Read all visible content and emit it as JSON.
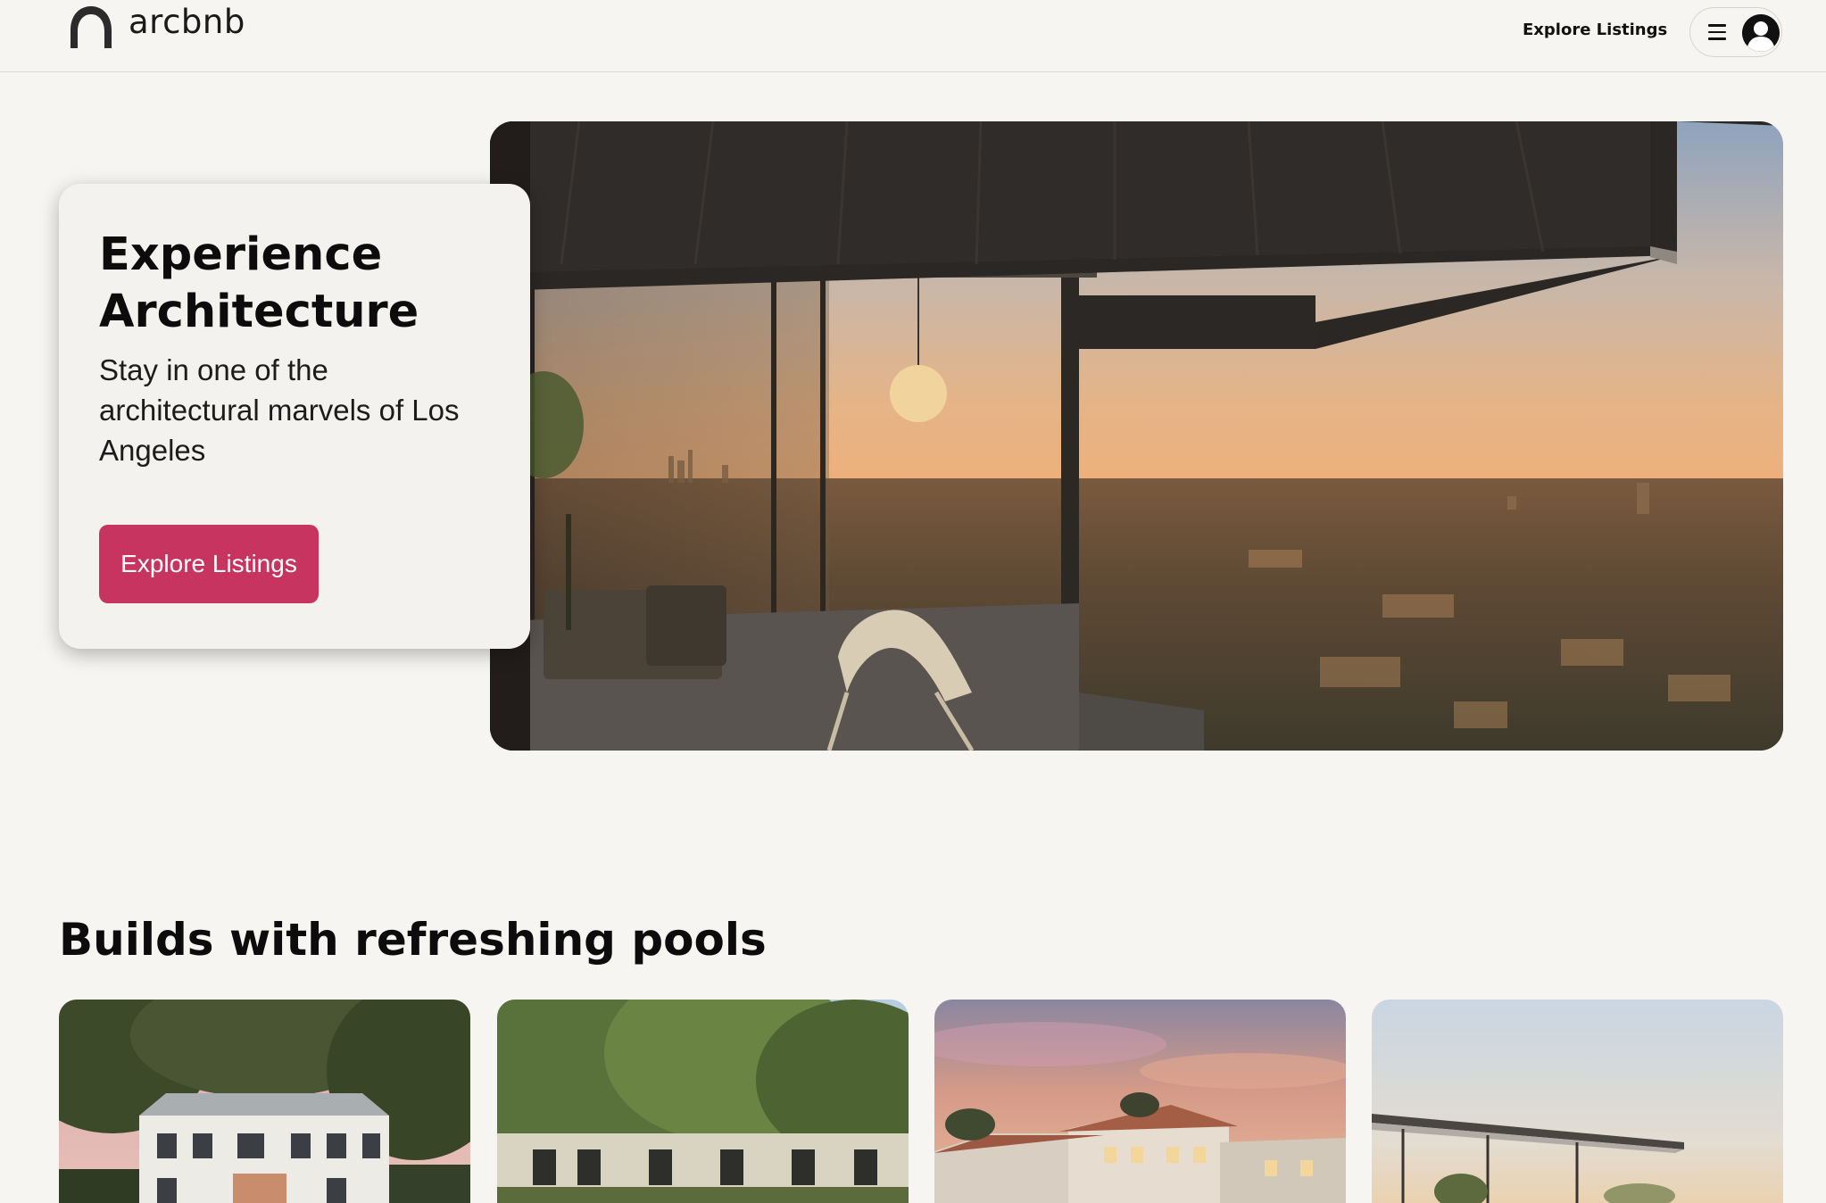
{
  "brand": {
    "name": "arcbnb",
    "icon": "arch-logo-icon"
  },
  "header": {
    "nav_link": "Explore Listings",
    "menu_icon": "hamburger-icon",
    "avatar_icon": "user-avatar-icon"
  },
  "hero": {
    "title": "Experience Architecture",
    "subtitle": "Stay in one of the architectural marvels of Los Angeles",
    "button_label": "Explore Listings",
    "image": "hillside-modern-house-city-view-photo"
  },
  "pools_section": {
    "title": "Builds with refreshing pools",
    "listings": [
      {
        "image": "white-colonial-house-photo"
      },
      {
        "image": "tree-shaded-house-photo"
      },
      {
        "image": "spanish-villa-sunset-photo"
      },
      {
        "image": "modern-pavilion-house-photo"
      }
    ]
  },
  "colors": {
    "background": "#f7f5f1",
    "accent": "#c73460",
    "text": "#0c0c0c"
  }
}
